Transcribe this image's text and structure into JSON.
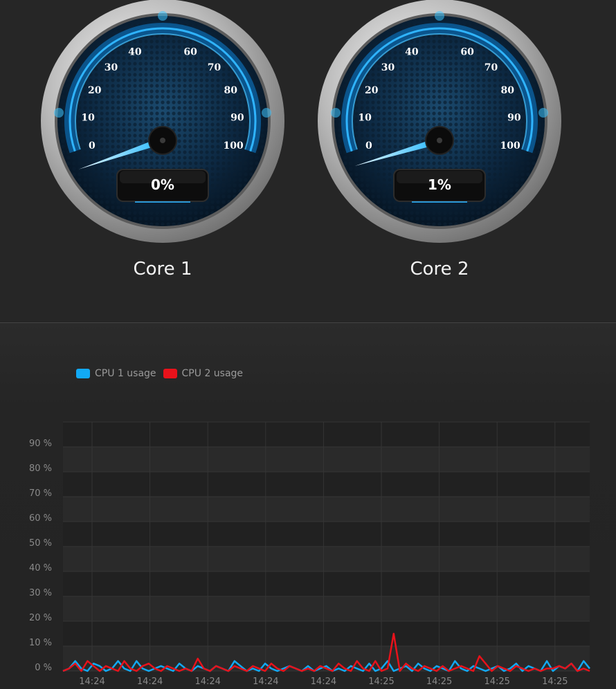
{
  "gauges": [
    {
      "label": "Core 1",
      "readout": "0%",
      "value": 0
    },
    {
      "label": "Core 2",
      "readout": "1%",
      "value": 1
    }
  ],
  "gauge_scale": {
    "ticks": [
      "0",
      "10",
      "20",
      "30",
      "40",
      "60",
      "70",
      "80",
      "90",
      "100"
    ],
    "min": 0,
    "max": 100
  },
  "legend": [
    {
      "label": "CPU 1 usage",
      "color": "#12a9f5"
    },
    {
      "label": "CPU 2 usage",
      "color": "#e8121b"
    }
  ],
  "chart_data": {
    "type": "line",
    "ylim": [
      0,
      100
    ],
    "y_ticks": [
      "0 %",
      "10 %",
      "20 %",
      "30 %",
      "40 %",
      "50 %",
      "60 %",
      "70 %",
      "80 %",
      "90 %"
    ],
    "x_tick_labels": [
      "14:24",
      "14:24",
      "14:24",
      "14:24",
      "14:24",
      "14:25",
      "14:25",
      "14:25",
      "14:25"
    ],
    "grid": true,
    "legend_position": "top-left",
    "series": [
      {
        "name": "CPU 1 usage",
        "color": "#12a9f5",
        "values": [
          0,
          1,
          4,
          1,
          0,
          3,
          2,
          0,
          1,
          4,
          1,
          0,
          4,
          1,
          0,
          1,
          2,
          1,
          0,
          3,
          1,
          0,
          2,
          1,
          0,
          2,
          1,
          0,
          4,
          2,
          0,
          1,
          0,
          3,
          1,
          0,
          1,
          2,
          1,
          0,
          2,
          0,
          1,
          2,
          0,
          1,
          0,
          2,
          1,
          0,
          3,
          0,
          1,
          4,
          0,
          1,
          2,
          0,
          3,
          1,
          0,
          2,
          1,
          0,
          4,
          1,
          0,
          2,
          1,
          0,
          1,
          2,
          0,
          1,
          3,
          0,
          2,
          1,
          0,
          4,
          0,
          2,
          1,
          3,
          0,
          4,
          1
        ]
      },
      {
        "name": "CPU 2 usage",
        "color": "#e8121b",
        "values": [
          0,
          1,
          3,
          0,
          4,
          2,
          0,
          2,
          1,
          0,
          4,
          1,
          0,
          2,
          3,
          1,
          0,
          2,
          1,
          0,
          1,
          0,
          5,
          1,
          0,
          2,
          1,
          0,
          2,
          1,
          0,
          2,
          1,
          0,
          3,
          1,
          0,
          2,
          1,
          0,
          1,
          0,
          2,
          1,
          0,
          3,
          1,
          0,
          4,
          1,
          0,
          4,
          0,
          1,
          15,
          0,
          3,
          1,
          0,
          2,
          1,
          0,
          2,
          0,
          1,
          2,
          1,
          0,
          6,
          3,
          0,
          2,
          1,
          0,
          2,
          1,
          0,
          1,
          0,
          1,
          1,
          2,
          1,
          3,
          0,
          1,
          0
        ]
      }
    ]
  }
}
